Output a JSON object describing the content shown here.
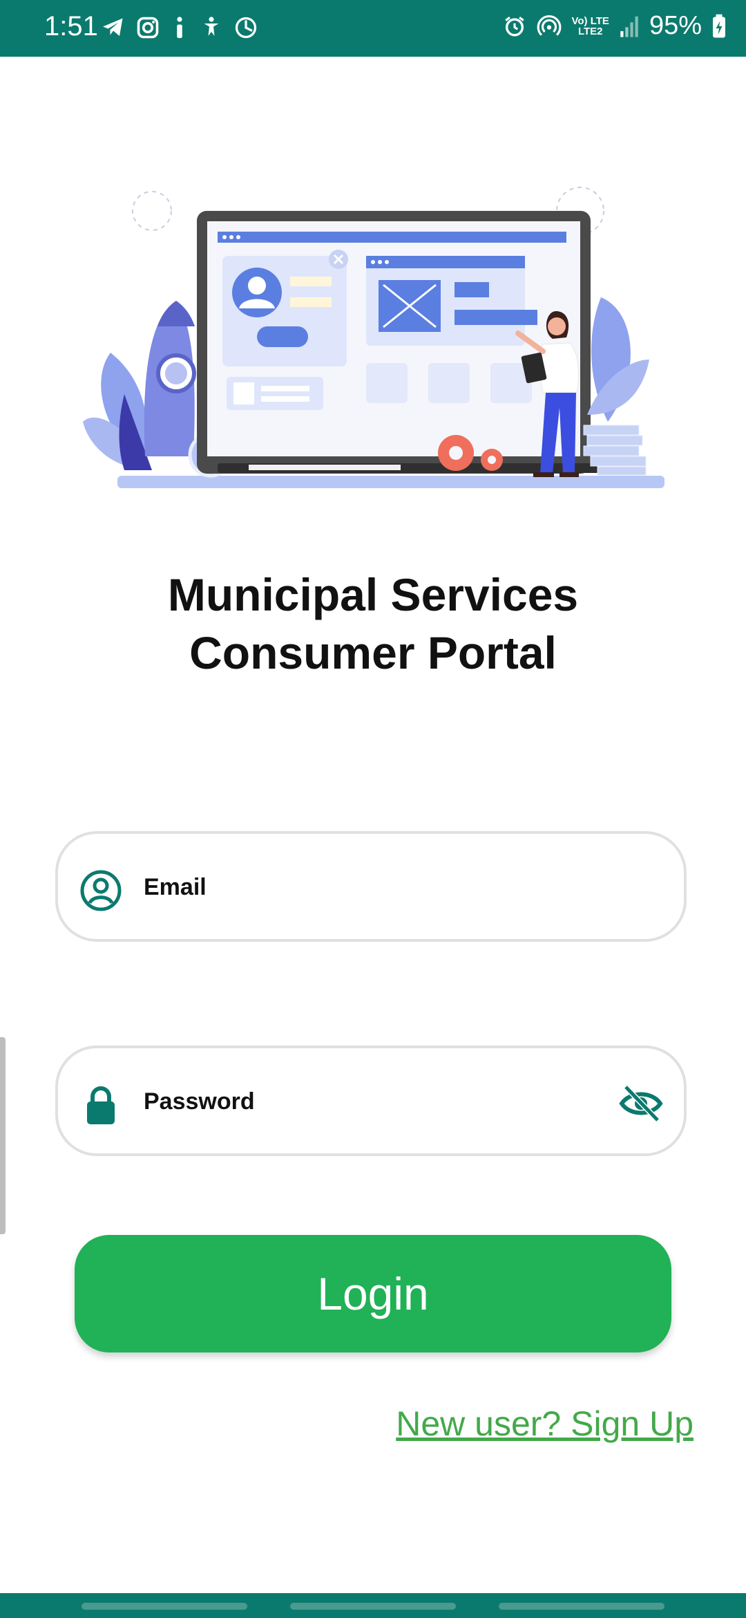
{
  "status_bar": {
    "time": "1:51",
    "battery": "95%",
    "network_top": "Vo) LTE",
    "network_bottom": "LTE2",
    "left_icons": [
      "telegram-icon",
      "instagram-icon",
      "info-icon",
      "accessibility-icon",
      "activity-icon"
    ],
    "right_icons": [
      "alarm-icon",
      "hotspot-icon",
      "signal-icon",
      "battery-icon"
    ],
    "color": "#0b7a6e"
  },
  "app": {
    "title_line1": "Municipal Services",
    "title_line2": "Consumer Portal"
  },
  "form": {
    "email_label": "Email",
    "password_label": "Password",
    "login_label": "Login",
    "signup_link": "New user? Sign Up"
  },
  "colors": {
    "primary": "#0b7a6e",
    "button": "#21b157",
    "link": "#43a94a"
  }
}
